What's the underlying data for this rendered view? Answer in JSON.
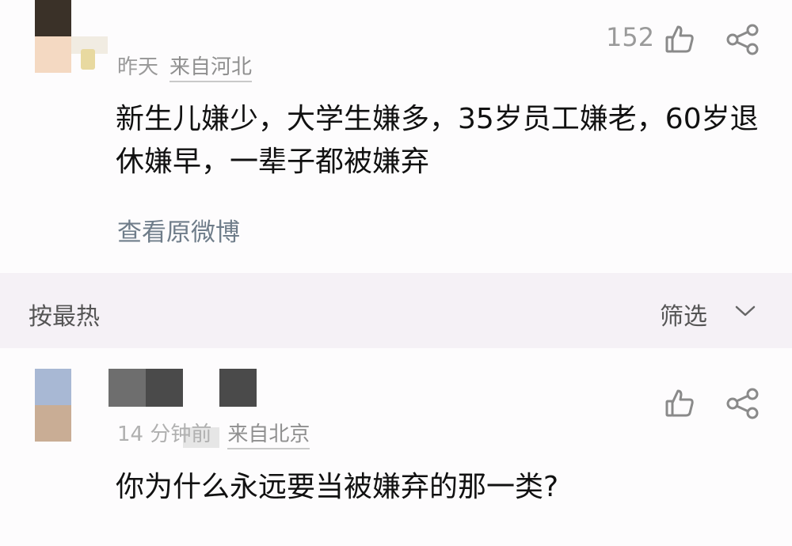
{
  "post": {
    "time": "昨天",
    "location": "来自河北",
    "like_count": "152",
    "text": "新生儿嫌少，大学生嫌多，35岁员工嫌老，60岁退休嫌早，一辈子都被嫌弃",
    "view_original": "查看原微博"
  },
  "sort_bar": {
    "sort_label": "按最热",
    "filter_label": "筛选"
  },
  "comment": {
    "time": "14 分钟前",
    "location": "来自北京",
    "text": "你为什么永远要当被嫌弃的那一类?"
  },
  "icons": {
    "like": "thumbs-up-icon",
    "share": "share-icon",
    "chevron": "chevron-down-icon"
  },
  "colors": {
    "background": "#fdfcfd",
    "sort_bar_background": "#f5f1f6",
    "meta_text": "#9a9a9a",
    "link_text": "#6f7d8a"
  }
}
